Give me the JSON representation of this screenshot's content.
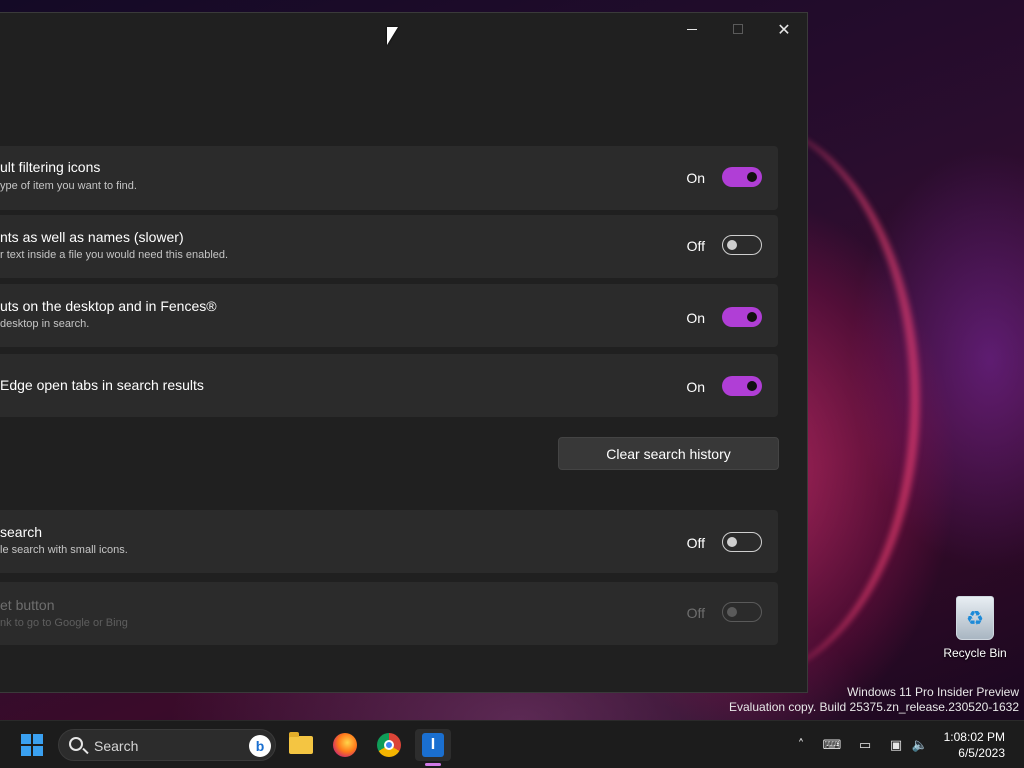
{
  "window": {
    "controls": {
      "minimize": "minimize",
      "maximize": "maximize",
      "close": "✕"
    }
  },
  "settings": [
    {
      "title": "ult filtering icons",
      "description": "ype of item you want to find.",
      "state": "On",
      "enabled": true,
      "on": true
    },
    {
      "title": "nts as well as names (slower)",
      "description": "r text inside a file you would need this enabled.",
      "state": "Off",
      "enabled": true,
      "on": false
    },
    {
      "title": "uts on the desktop and in Fences®",
      "description": "desktop in search.",
      "state": "On",
      "enabled": true,
      "on": true
    },
    {
      "title": "Edge open tabs in search results",
      "description": "",
      "state": "On",
      "enabled": true,
      "on": true
    },
    {
      "title": "search",
      "description": "le search with small icons.",
      "state": "Off",
      "enabled": true,
      "on": false
    },
    {
      "title": "et button",
      "description": "nk to go to Google or Bing",
      "state": "Off",
      "enabled": false,
      "on": false
    }
  ],
  "clear_history_button": "Clear search history",
  "desktop": {
    "recycle_bin_label": "Recycle Bin",
    "watermark_line1": "Windows 11 Pro Insider Preview",
    "watermark_line2": "Evaluation copy. Build 25375.zn_release.230520-1632"
  },
  "taskbar": {
    "search_placeholder": "Search",
    "bing_label": "b",
    "app_label": "I",
    "time": "1:08:02 PM",
    "date": "6/5/2023",
    "tray_icons": [
      "chevron-up-icon",
      "keyboard-icon",
      "display-icon",
      "network-icon",
      "volume-icon"
    ]
  },
  "colors": {
    "accent": "#b03ed6",
    "window_bg": "#202020",
    "card_bg": "#2b2b2b",
    "taskbar_bg": "#1c1c1c"
  }
}
